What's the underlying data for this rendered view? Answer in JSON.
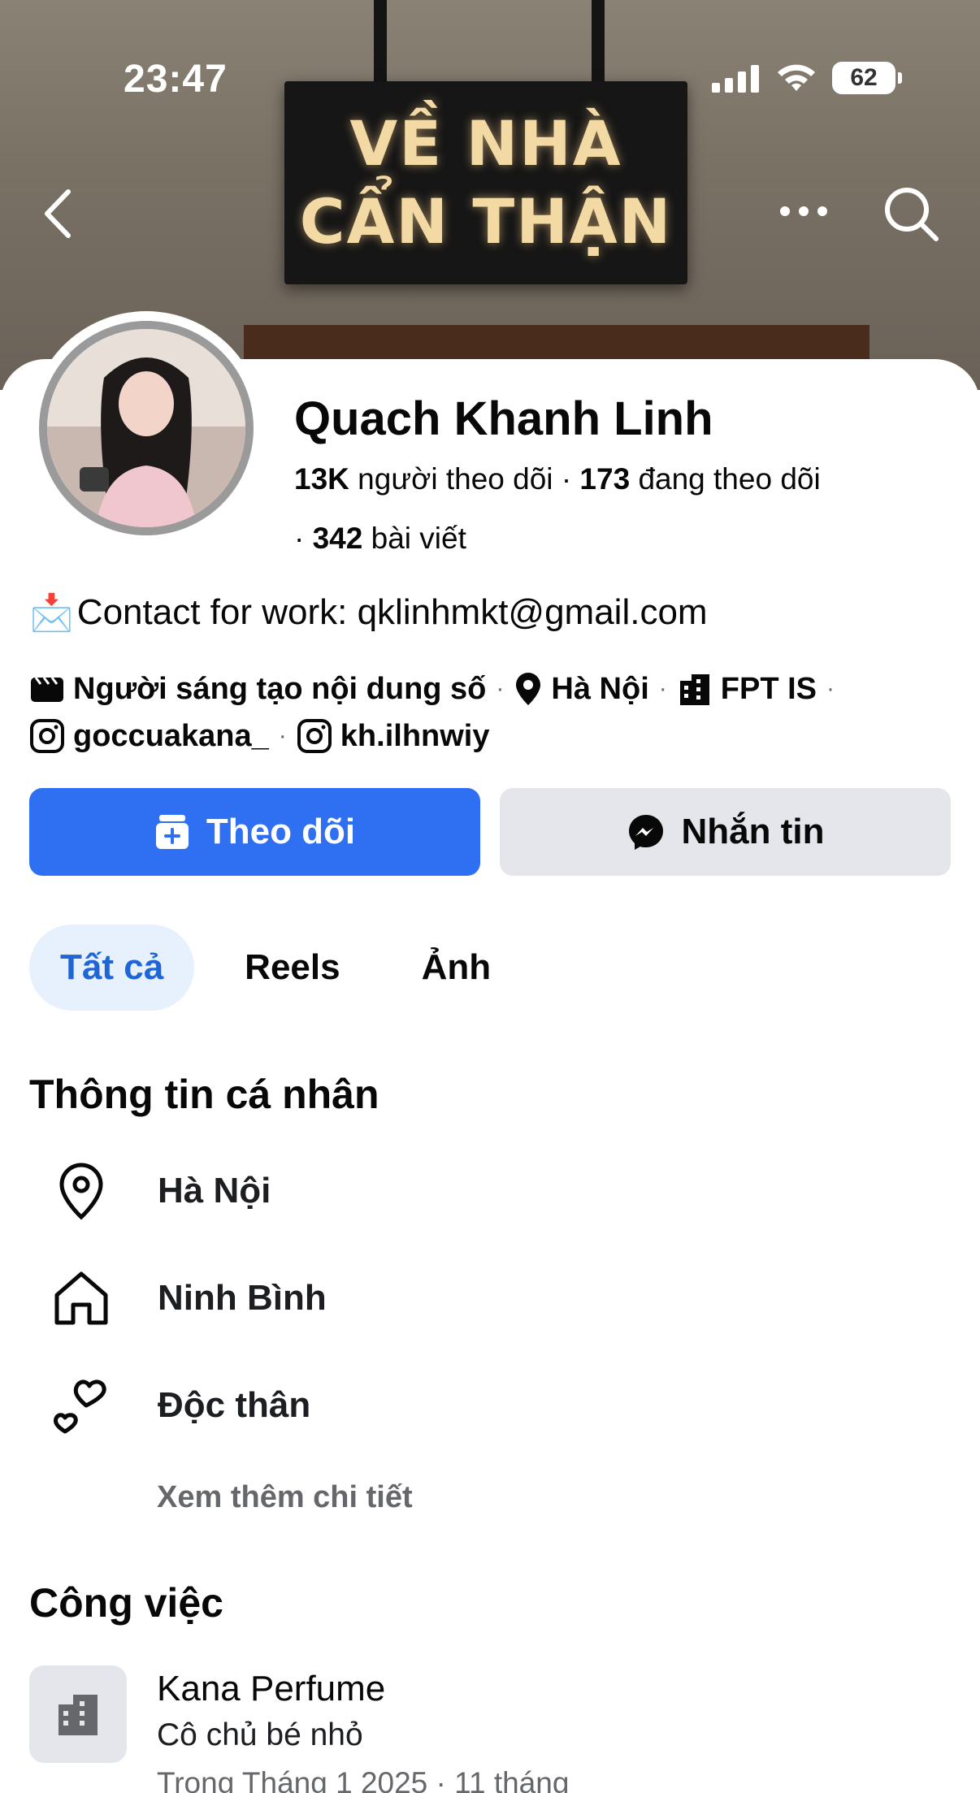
{
  "status_bar": {
    "time": "23:47",
    "battery": "62"
  },
  "cover": {
    "sign_line1": "VỀ NHÀ",
    "sign_line2": "CẨN THẬN"
  },
  "profile": {
    "name": "Quach Khanh Linh",
    "followers_count": "13K",
    "followers_label": "người theo dõi",
    "following_count": "173",
    "following_label": "đang theo dõi",
    "posts_count": "342",
    "posts_label": "bài viết",
    "bio_emoji": "📩",
    "bio": "Contact for work: qklinhmkt@gmail.com"
  },
  "details": {
    "category": "Người sáng tạo nội dung số",
    "location": "Hà Nội",
    "workplace": "FPT IS",
    "instagram1": "goccuakana_",
    "instagram2": "kh.ilhnwiy"
  },
  "actions": {
    "follow": "Theo dõi",
    "message": "Nhắn tin"
  },
  "tabs": [
    {
      "label": "Tất cả",
      "active": true
    },
    {
      "label": "Reels",
      "active": false
    },
    {
      "label": "Ảnh",
      "active": false
    }
  ],
  "personal_info": {
    "title": "Thông tin cá nhân",
    "items": [
      {
        "icon": "location-pin-icon",
        "text": "Hà Nội"
      },
      {
        "icon": "home-icon",
        "text": "Ninh Bình"
      },
      {
        "icon": "hearts-icon",
        "text": "Độc thân"
      }
    ],
    "see_more": "Xem thêm chi tiết"
  },
  "work": {
    "title": "Công việc",
    "company": "Kana Perfume",
    "role": "Cô chủ bé nhỏ",
    "date": "Trong Tháng 1 2025 · 11 tháng"
  },
  "colors": {
    "accent": "#2f6ff1",
    "tab_active_bg": "#e7f0fd",
    "tab_active_text": "#1f65d6",
    "secondary_bg": "#e4e6eb",
    "muted_text": "#65676b"
  }
}
